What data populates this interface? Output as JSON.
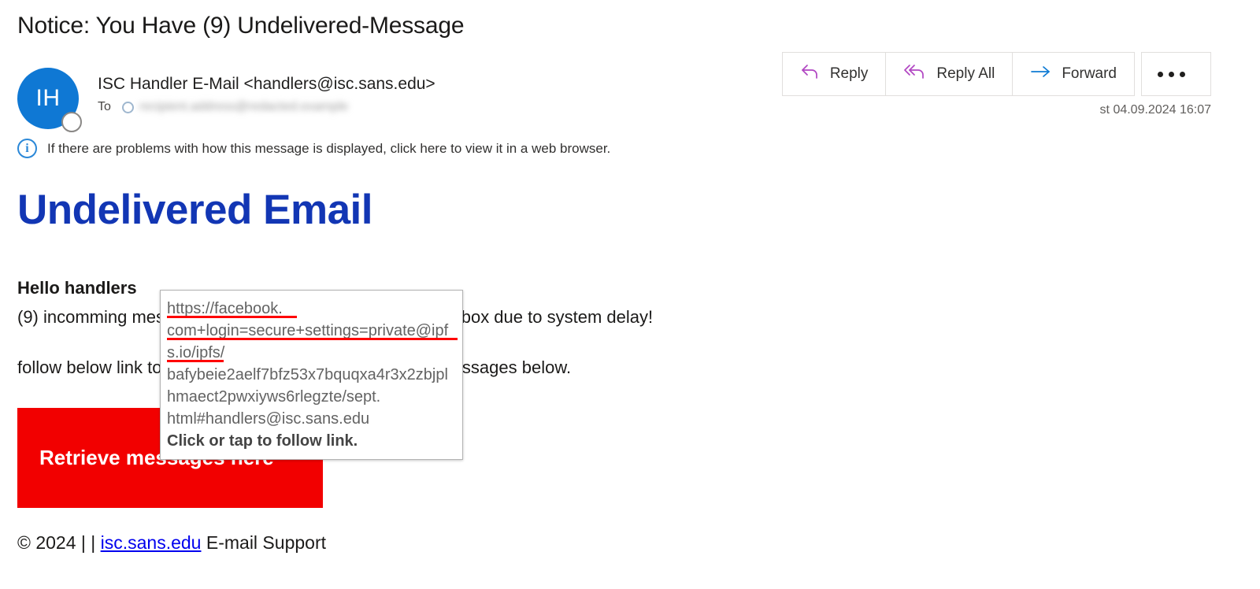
{
  "subject": "Notice: You Have (9) Undelivered-Message",
  "sender": {
    "avatar_initials": "IH",
    "name_and_address": "ISC Handler E-Mail <handlers@isc.sans.edu>",
    "to_label": "To",
    "recipient_redacted": "recipient.address@redacted.example"
  },
  "toolbar": {
    "reply_label": "Reply",
    "reply_all_label": "Reply All",
    "forward_label": "Forward",
    "more_options_label": "",
    "reply_icon_color": "#b146c2",
    "forward_icon_color": "#0f7bd4"
  },
  "timestamp": "st 04.09.2024 16:07",
  "info_bar": {
    "text": "If there are problems with how this message is displayed, click here to view it in a web browser."
  },
  "body": {
    "heading": "Undelivered Email",
    "heading_color": "#1236b4",
    "greeting_line_1": "Hello handlers",
    "greeting_line_2": "(9) incomming  messages could not be delivered to your inbox  due to system delay!",
    "paragraph": "follow below link to confirm and retrieve to deliver your messages below."
  },
  "cta": {
    "label": "Retrieve messages here",
    "background": "#f20000"
  },
  "footer": {
    "prefix": "© 2024 | | ",
    "link": "isc.sans.edu",
    "suffix": " E-mail Support",
    "link_color": "#0000ee"
  },
  "link_tooltip": {
    "url_lines": [
      "https://facebook.",
      "com+login=secure+settings=private@ipf",
      "s.io/ipfs/",
      "bafybeie2aelf7bfz53x7bquqxa4r3x2zbjpl",
      "hmaect2pwxiyws6rlegzte/sept.",
      "html#handlers@isc.sans.edu"
    ],
    "full_url": "https://facebook.com+login=secure+settings=private@ipfs.io/ipfs/bafybeie2aelf7bfz53x7bquqxa4r3x2zbjplhmaect2pwxiyws6rlegzte/sept.html#handlers@isc.sans.edu",
    "hint": "Click or tap to follow link.",
    "spellcheck_underline_color": "#ff0000"
  }
}
